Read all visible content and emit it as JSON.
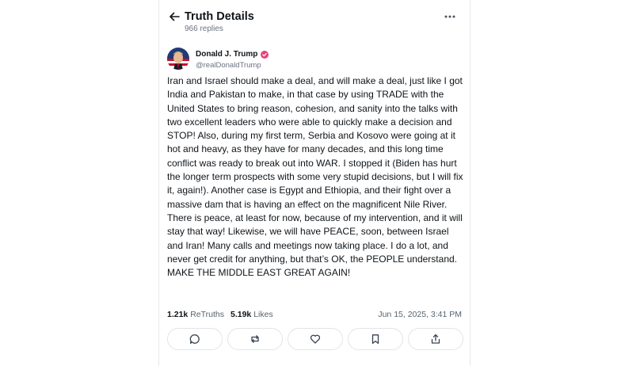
{
  "header": {
    "title": "Truth Details",
    "replies": "966 replies"
  },
  "author": {
    "name": "Donald J. Trump",
    "handle": "@realDonaldTrump"
  },
  "post": {
    "text": "Iran and Israel should make a deal, and will make a deal, just like I got India and Pakistan to make, in that case by using TRADE with the United States to bring reason, cohesion, and sanity into the talks with two excellent leaders who were able to quickly make a decision and STOP!  Also, during my first term, Serbia and Kosovo were going at it hot and heavy, as they have for many decades, and this long time conflict was ready to break out into WAR. I stopped it (Biden has hurt the longer term prospects with some very stupid decisions, but I will fix it, again!). Another case is Egypt and Ethiopia, and their fight over a massive dam that is having an effect on the magnificent Nile River. There is peace, at least for now, because of my intervention, and it will stay that way! Likewise, we will have PEACE, soon, between Israel and Iran! Many calls and meetings now taking place. I do a lot, and never get credit for anything, but that’s OK, the PEOPLE understand. MAKE THE MIDDLE EAST GREAT AGAIN!"
  },
  "stats": {
    "retruths_count": "1.21k",
    "retruths_label": "ReTruths",
    "likes_count": "5.19k",
    "likes_label": "Likes",
    "timestamp": "Jun 15, 2025, 3:41 PM"
  },
  "actions": [
    {
      "icon": "reply-icon"
    },
    {
      "icon": "retruth-icon"
    },
    {
      "icon": "like-icon"
    },
    {
      "icon": "bookmark-icon"
    },
    {
      "icon": "share-icon"
    }
  ],
  "colors": {
    "verified": "#e8437a",
    "muted": "#6b7280",
    "border": "#e1e4e8"
  }
}
